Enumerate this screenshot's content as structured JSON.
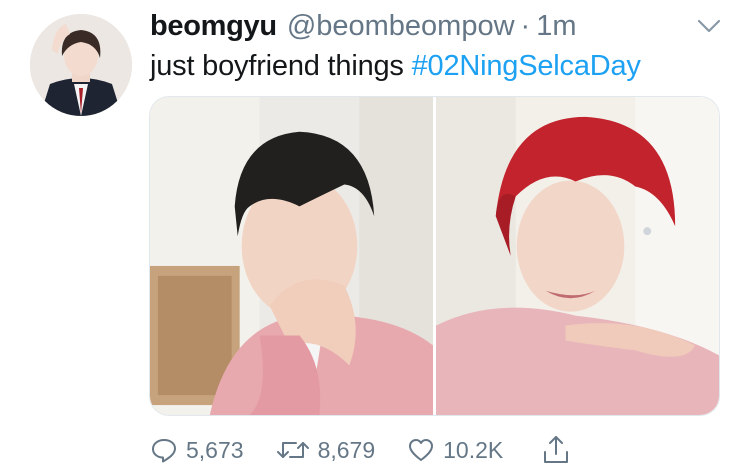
{
  "tweet": {
    "display_name": "beomgyu",
    "handle": "@beombeompow",
    "separator": "·",
    "time": "1m",
    "text": "just boyfriend things ",
    "hashtag": "#02NingSelcaDay"
  },
  "actions": {
    "replies": "5,673",
    "retweets": "8,679",
    "likes": "10.2K"
  },
  "icons": {
    "reply": "reply-icon",
    "retweet": "retweet-icon",
    "like": "like-icon",
    "share": "share-icon",
    "menu": "chevron-down-icon"
  },
  "colors": {
    "link": "#1da1f2",
    "secondary_text": "#657786",
    "primary_text": "#14171a"
  }
}
